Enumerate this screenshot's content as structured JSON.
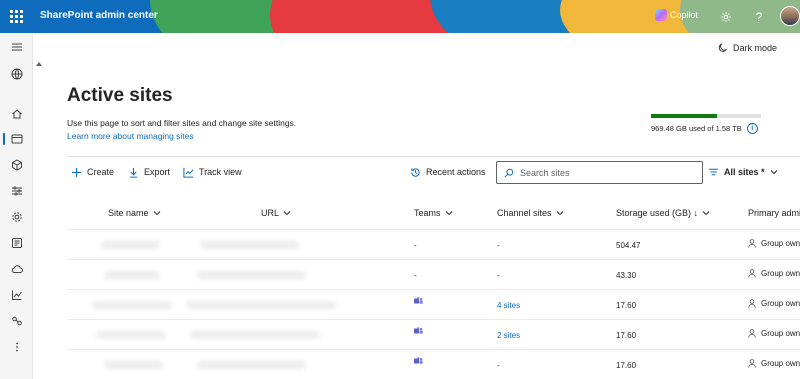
{
  "header": {
    "app_title": "SharePoint admin center",
    "copilot_label": "Copilot",
    "brand_color": "#0f6cbd"
  },
  "rail": {
    "icons": [
      "menu-icon",
      "globe-icon",
      "home-icon",
      "sites-icon",
      "policies-icon",
      "settings-icon",
      "gear-icon",
      "reports-icon",
      "migration-icon",
      "insights-icon",
      "connections-icon",
      "more-icon"
    ]
  },
  "dark_mode_label": "Dark mode",
  "page": {
    "title": "Active sites",
    "description": "Use this page to sort and filter sites and change site settings.",
    "learn_link": "Learn more about managing sites"
  },
  "storage": {
    "text": "969.48 GB used of 1.58 TB",
    "used_fraction": 0.6
  },
  "commands": {
    "create": "Create",
    "export": "Export",
    "track_view": "Track view",
    "recent_actions": "Recent actions",
    "search_placeholder": "Search sites",
    "filter": "All sites *"
  },
  "table": {
    "columns": {
      "site_name": "Site name",
      "url": "URL",
      "teams": "Teams",
      "channel_sites": "Channel sites",
      "storage_used": "Storage used (GB) ↓",
      "primary_admin": "Primary admin"
    },
    "rows": [
      {
        "teams": "-",
        "channel_sites": "-",
        "storage": "504.47",
        "admin": "Group owners"
      },
      {
        "teams": "-",
        "channel_sites": "-",
        "storage": "43.30",
        "admin": "Group owners"
      },
      {
        "teams": "teams-icon",
        "channel_sites": "4 sites",
        "storage": "17.60",
        "admin": "Group owners"
      },
      {
        "teams": "teams-icon",
        "channel_sites": "2 sites",
        "storage": "17.60",
        "admin": "Group owners"
      },
      {
        "teams": "teams-icon",
        "channel_sites": "-",
        "storage": "17.60",
        "admin": "Group owners"
      }
    ]
  }
}
